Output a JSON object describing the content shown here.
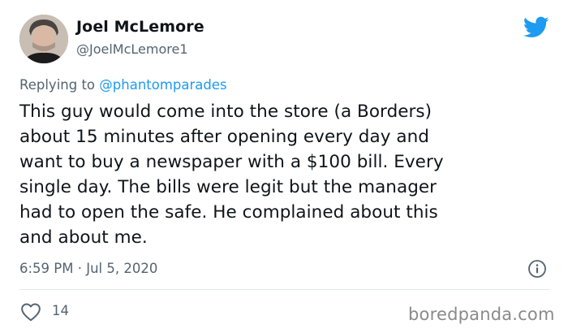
{
  "author": {
    "name": "Joel McLemore",
    "handle": "@JoelMcLemore1"
  },
  "reply": {
    "prefix": "Replying to",
    "mention": "@phantomparades"
  },
  "tweet": {
    "text": "This guy would come into the store (a Borders)\nabout 15 minutes after opening every day and\nwant to buy a newspaper with a $100 bill.  Every\nsingle day.  The bills were legit but the manager\nhad to open the safe. He complained about this\nand about me."
  },
  "meta": {
    "timestamp": "6:59 PM · Jul 5, 2020"
  },
  "engagement": {
    "likes": "14"
  },
  "watermark": "boredpanda.com",
  "icons": {
    "brand": "twitter-bird-icon",
    "info": "info-icon",
    "like": "heart-icon"
  },
  "colors": {
    "twitter_blue": "#1d9bf0",
    "secondary_text": "#536471",
    "primary_text": "#0f1419"
  }
}
